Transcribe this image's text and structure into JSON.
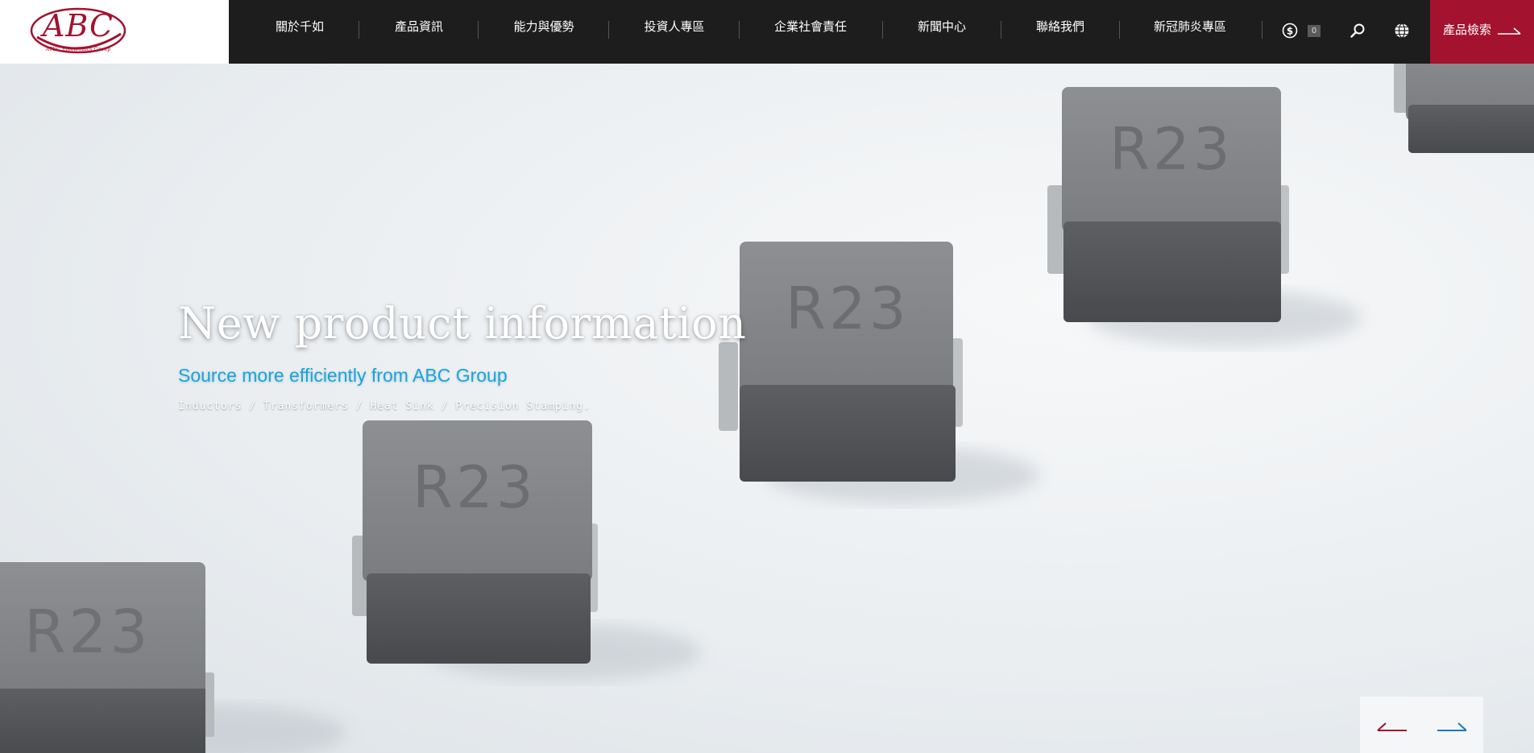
{
  "brand": {
    "logo_text": "ABC",
    "logo_subtitle": "ATEC Electronics Group",
    "accent_color": "#a3122e",
    "highlight_color": "#13a6df"
  },
  "nav": {
    "items": [
      {
        "label": "關於千如"
      },
      {
        "label": "產品資訊"
      },
      {
        "label": "能力與優勢"
      },
      {
        "label": "投資人專區"
      },
      {
        "label": "企業社會責任"
      },
      {
        "label": "新聞中心"
      },
      {
        "label": "聯絡我們"
      },
      {
        "label": "新冠肺炎專區"
      }
    ],
    "cart_count": "0",
    "product_search_label": "產品檢索"
  },
  "hero": {
    "title": "New product information",
    "subtitle": "Source more efficiently from ABC Group",
    "description": "Inductors / Transformers / Heat Sink / Precision Stamping.",
    "chip_marking": "R23"
  },
  "icons": {
    "currency": "dollar-icon",
    "search": "search-icon",
    "language": "globe-icon",
    "prev": "arrow-left-icon",
    "next": "arrow-right-icon"
  }
}
